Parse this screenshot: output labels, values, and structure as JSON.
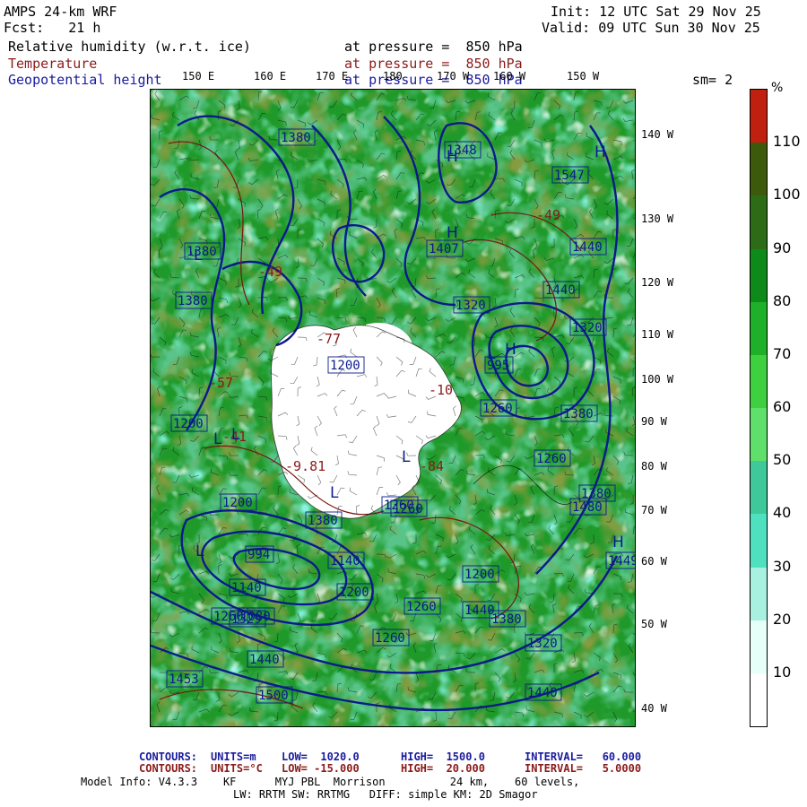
{
  "header": {
    "model": "AMPS 24-km WRF",
    "fcst": "Fcst:   21 h",
    "init": "Init: 12 UTC Sat 29 Nov 25",
    "valid": "Valid: 09 UTC Sun 30 Nov 25",
    "field1_name": "Relative humidity (w.r.t. ice)",
    "field1_level": "at pressure =  850 hPa",
    "field2_name": "Temperature",
    "field2_level": "at pressure =  850 hPa",
    "field3_name": "Geopotential height",
    "field3_level": "at pressure =  850 hPa",
    "smoothing": "sm= 2"
  },
  "top_longitudes": [
    "150 E",
    "160 E",
    "170 E",
    "180",
    "170 W",
    "160 W",
    "150 W"
  ],
  "right_longitudes": [
    "140 W",
    "130 W",
    "120 W",
    "110 W",
    "100 W",
    "90 W",
    "80 W",
    "70 W",
    "60 W",
    "50 W",
    "40 W"
  ],
  "colorbar": {
    "unit": "%",
    "labels": [
      "110",
      "100",
      "90",
      "80",
      "70",
      "60",
      "50",
      "40",
      "30",
      "20",
      "10"
    ],
    "colors": [
      "#c0200f",
      "#3d5a0c",
      "#2d6b16",
      "#0e8a1a",
      "#1fb02a",
      "#3fd03f",
      "#5fe06a",
      "#3fc89a",
      "#4fe0c0",
      "#a8f0e0",
      "#e6fff8",
      "#ffffff"
    ]
  },
  "map_labels": {
    "heights": [
      "1380",
      "1348",
      "1547",
      "1440",
      "1380",
      "1407",
      "1440",
      "1380",
      "1320",
      "1320",
      "1200",
      "1380",
      "1260",
      "995",
      "1260",
      "1140",
      "1200",
      "1380",
      "1260",
      "1200",
      "1200",
      "1200",
      "1140",
      "994",
      "1260",
      "1080",
      "1260",
      "1380",
      "1260",
      "1320",
      "1329",
      "1440",
      "1500",
      "1440",
      "1453",
      "1440",
      "1260",
      "1380",
      "1449",
      "1480"
    ],
    "temps": [
      "-9.81",
      "-77",
      "-10",
      "-49",
      "-49",
      "-57",
      "-41",
      "-84"
    ],
    "highs": [
      "H",
      "H",
      "H",
      "H",
      "H"
    ],
    "lows": [
      "L",
      "L",
      "L",
      "L",
      "L",
      "L",
      "L"
    ]
  },
  "footer": {
    "c1_label": "CONTOURS:",
    "c1_units": "UNITS=m",
    "c1_low": "LOW=  1020.0",
    "c1_high": "HIGH=  1500.0",
    "c1_interval": "INTERVAL=   60.000",
    "c2_label": "CONTOURS:",
    "c2_units": "UNITS=°C",
    "c2_low": "LOW= -15.000",
    "c2_high": "HIGH=  20.000",
    "c2_interval": "INTERVAL=   5.0000",
    "model_info": "Model Info: V4.3.3    KF      MYJ PBL  Morrison          24 km,    60 levels,",
    "model_info2": "LW: RRTM SW: RRTMG   DIFF: simple KM: 2D Smagor"
  }
}
